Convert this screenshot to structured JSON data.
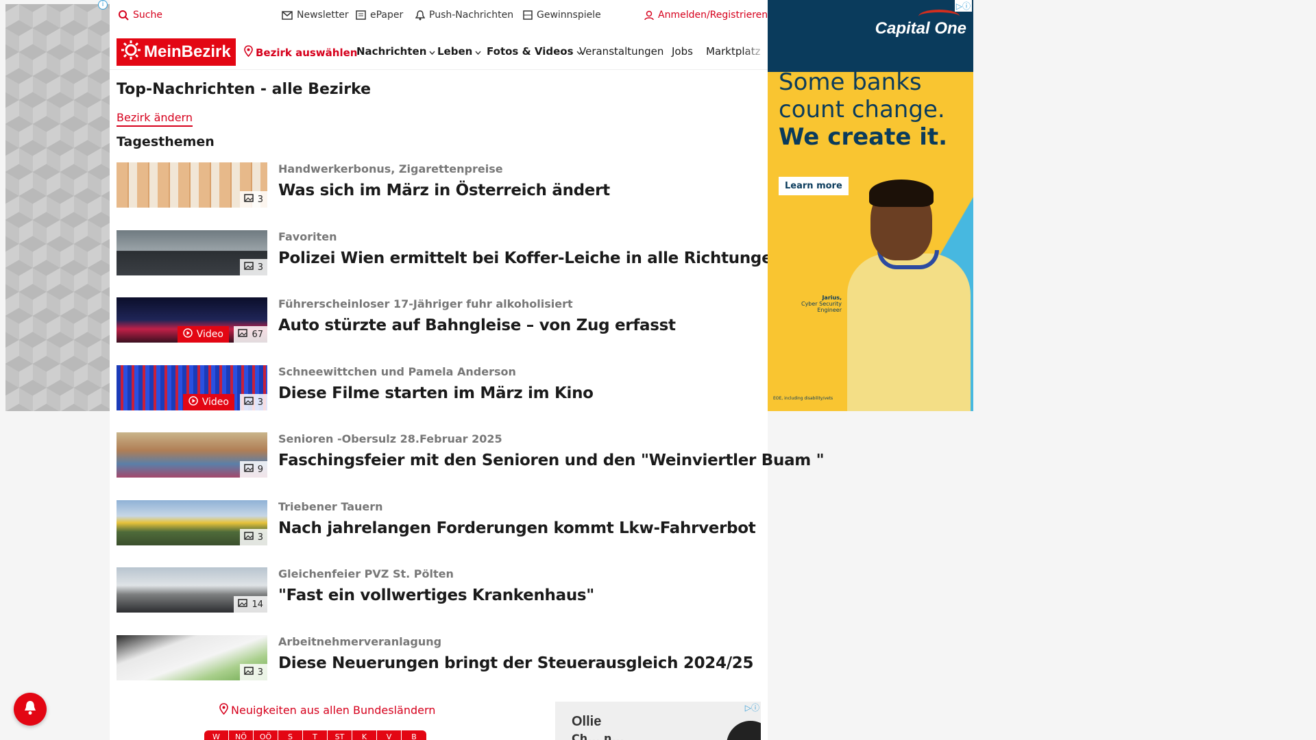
{
  "topbar": {
    "search": "Suche",
    "newsletter": "Newsletter",
    "epaper": "ePaper",
    "push": "Push-Nachrichten",
    "gewinnspiele": "Gewinnspiele",
    "login": "Anmelden/Registrieren"
  },
  "nav": {
    "logo": "MeinBezirk",
    "bezirk": "Bezirk auswählen",
    "items": [
      "Nachrichten",
      "Leben",
      "Fotos & Videos",
      "Veranstaltungen",
      "Jobs",
      "Marktplatz"
    ]
  },
  "page": {
    "title": "Top-Nachrichten - alle Bezirke",
    "change_link": "Bezirk ändern",
    "section": "Tagesthemen"
  },
  "articles": [
    {
      "kicker": "Handwerkerbonus, Zigarettenpreise",
      "headline": "Was sich im März in Österreich ändert",
      "count": "3",
      "video": ""
    },
    {
      "kicker": "Favoriten",
      "headline": "Polizei Wien ermittelt bei Koffer-Leiche in alle Richtungen",
      "count": "3",
      "video": ""
    },
    {
      "kicker": "Führerscheinloser 17-Jähriger fuhr alkoholisiert",
      "headline": "Auto stürzte auf Bahngleise – von Zug erfasst",
      "count": "67",
      "video": "Video"
    },
    {
      "kicker": "Schneewittchen und Pamela Anderson",
      "headline": "Diese Filme starten im März im Kino",
      "count": "3",
      "video": "Video"
    },
    {
      "kicker": "Senioren -Obersulz 28.Februar 2025",
      "headline": "Faschingsfeier mit den Senioren und den \"Weinviertler Buam \"",
      "count": "9",
      "video": ""
    },
    {
      "kicker": "Triebener Tauern",
      "headline": "Nach jahrelangen Forderungen kommt Lkw-Fahrverbot",
      "count": "3",
      "video": ""
    },
    {
      "kicker": "Gleichenfeier PVZ St. Pölten",
      "headline": "\"Fast ein vollwertiges Krankenhaus\"",
      "count": "14",
      "video": ""
    },
    {
      "kicker": "Arbeitnehmerveranlagung",
      "headline": "Diese Neuerungen bringt der Steuerausgleich 2024/25",
      "count": "3",
      "video": ""
    }
  ],
  "footer": {
    "bundes_link": "Neuigkeiten aus allen Bundesländern",
    "states": [
      "W",
      "NÖ",
      "OÖ",
      "S",
      "T",
      "ST",
      "K",
      "V",
      "B"
    ]
  },
  "ad_right": {
    "brand": "Capital One",
    "line1": "Some banks",
    "line2": "count change.",
    "line3": "We create it.",
    "cta": "Learn more",
    "person_name": "Jarius,",
    "person_title": "Cyber Security Engineer",
    "fine": "EOE, including disability/vets"
  },
  "ad_small": {
    "t1": "Ollie",
    "t2": "Ch... n..."
  },
  "colors": {
    "brand_red": "#e30613",
    "link_red": "#d6001c",
    "ad_navy": "#0a3b5c",
    "ad_yellow": "#f9c531",
    "ad_cyan": "#47b8e0"
  }
}
